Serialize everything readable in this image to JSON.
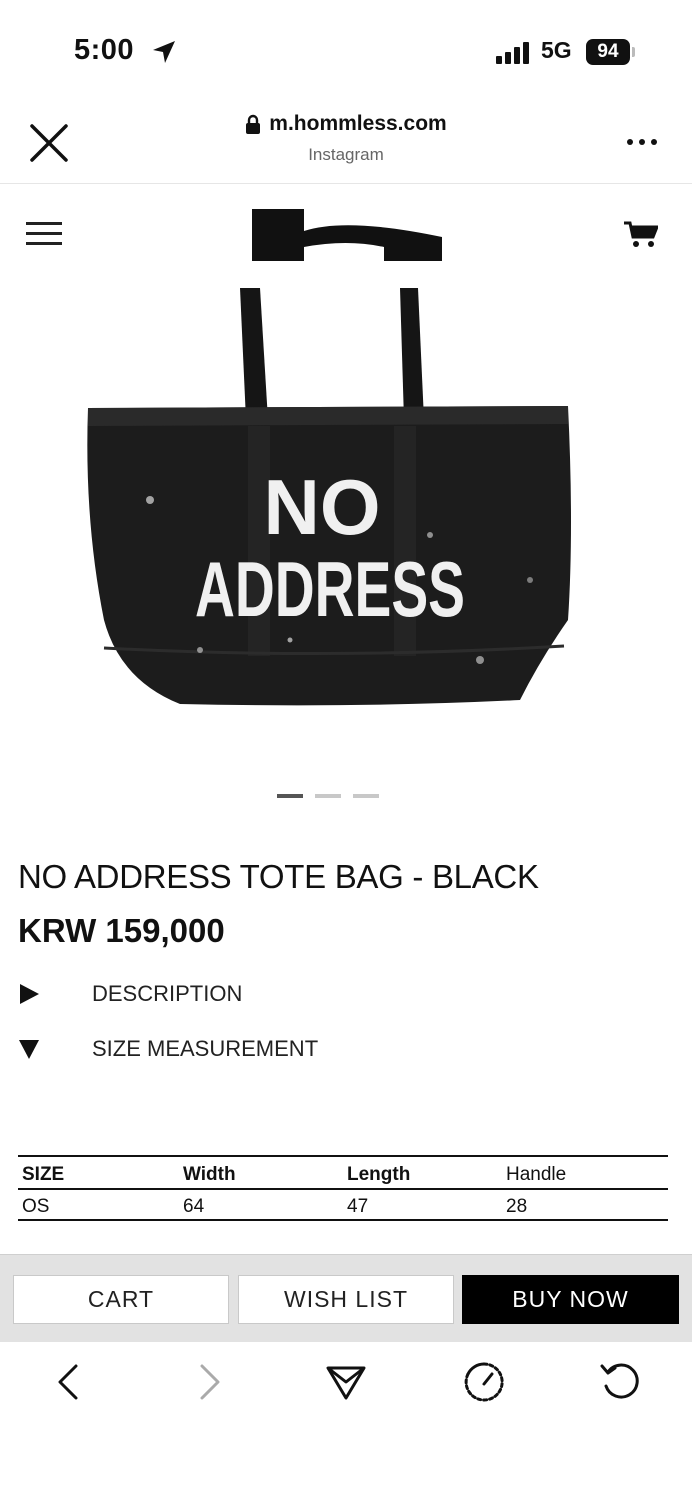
{
  "status_bar": {
    "time": "5:00",
    "network": "5G",
    "battery": "94"
  },
  "browser": {
    "url": "m.hommless.com",
    "source": "Instagram"
  },
  "product": {
    "image_text_line1": "NO",
    "image_text_line2": "ADDRESS",
    "title": "NO ADDRESS TOTE BAG - BLACK",
    "price": "KRW 159,000",
    "carousel": {
      "count": 3,
      "active_index": 0
    }
  },
  "accordion": [
    {
      "label": "DESCRIPTION",
      "state": "collapsed"
    },
    {
      "label": "SIZE MEASUREMENT",
      "state": "expanded"
    }
  ],
  "size_table": {
    "headers": [
      "SIZE",
      "Width",
      "Length",
      "Handle"
    ],
    "rows": [
      [
        "OS",
        "64",
        "47",
        "28"
      ]
    ]
  },
  "actions": {
    "cart": "CART",
    "wishlist": "WISH LIST",
    "buy_now": "BUY NOW"
  },
  "toolbar": {
    "icons": [
      "back-icon",
      "forward-icon",
      "share-icon",
      "speed-icon",
      "reload-icon"
    ]
  },
  "colors": {
    "accent_buy": "#000000",
    "action_bar_bg": "#e2e2e2"
  }
}
